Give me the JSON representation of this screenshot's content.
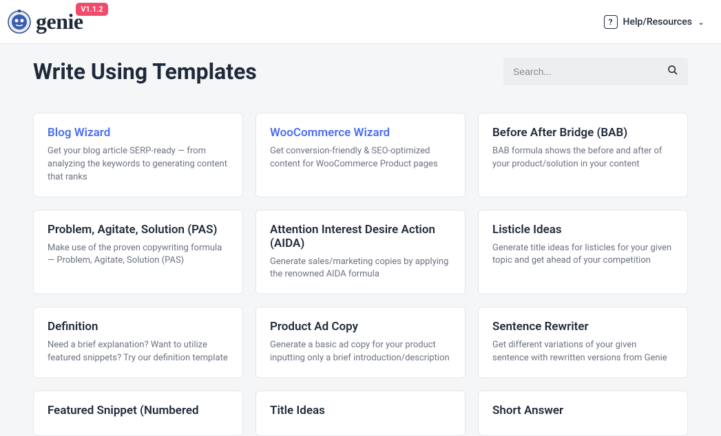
{
  "header": {
    "brand": "genie",
    "version": "V1.1.2",
    "help_label": "Help/Resources"
  },
  "page_title": "Write Using Templates",
  "search": {
    "placeholder": "Search..."
  },
  "templates": [
    {
      "title": "Blog Wizard",
      "featured": true,
      "desc": "Get your blog article SERP-ready — from analyzing the keywords to generating content that ranks"
    },
    {
      "title": "WooCommerce Wizard",
      "featured": true,
      "desc": "Get conversion-friendly & SEO-optimized content for WooCommerce Product pages"
    },
    {
      "title": "Before After Bridge (BAB)",
      "featured": false,
      "desc": "BAB formula shows the before and after of your product/solution in your content"
    },
    {
      "title": "Problem, Agitate, Solution (PAS)",
      "featured": false,
      "desc": "Make use of the proven copywriting formula — Problem, Agitate, Solution (PAS)"
    },
    {
      "title": "Attention Interest Desire Action (AIDA)",
      "featured": false,
      "desc": "Generate sales/marketing copies by applying the renowned AIDA formula"
    },
    {
      "title": "Listicle Ideas",
      "featured": false,
      "desc": "Generate title ideas for listicles for your given topic and get ahead of your competition"
    },
    {
      "title": "Definition",
      "featured": false,
      "desc": "Need a brief explanation? Want to utilize featured snippets? Try our definition template"
    },
    {
      "title": "Product Ad Copy",
      "featured": false,
      "desc": "Generate a basic ad copy for your product inputting only a brief introduction/description"
    },
    {
      "title": "Sentence Rewriter",
      "featured": false,
      "desc": "Get different variations of your given sentence with rewritten versions from Genie"
    },
    {
      "title": "Featured Snippet (Numbered",
      "featured": false,
      "desc": ""
    },
    {
      "title": "Title Ideas",
      "featured": false,
      "desc": ""
    },
    {
      "title": "Short Answer",
      "featured": false,
      "desc": ""
    }
  ]
}
